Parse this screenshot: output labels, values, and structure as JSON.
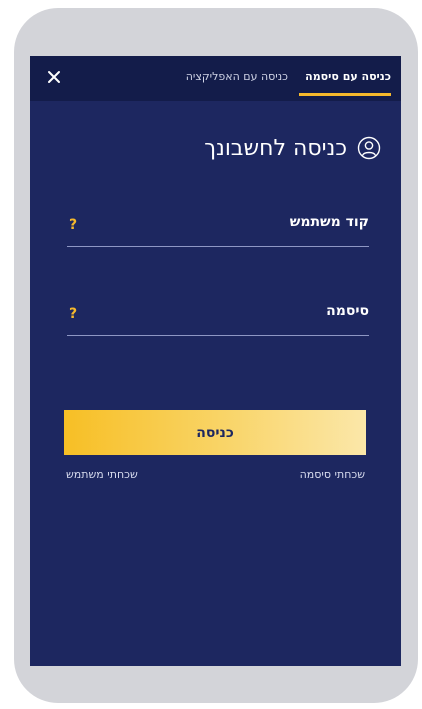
{
  "tabs": {
    "password_login": "כניסה עם סיסמה",
    "app_login": "כניסה עם האפליקציה"
  },
  "close_icon": "close-icon",
  "title": "כניסה לחשבונך",
  "title_icon": "user-circle-icon",
  "form": {
    "username_label": "קוד משתמש",
    "password_label": "סיסמה",
    "help_symbol": "?"
  },
  "login_button": "כניסה",
  "links": {
    "forgot_password": "שכחתי סיסמה",
    "forgot_username": "שכחתי משתמש"
  },
  "colors": {
    "background": "#1d2760",
    "topbar": "#131c4a",
    "accent": "#f5b82c"
  }
}
